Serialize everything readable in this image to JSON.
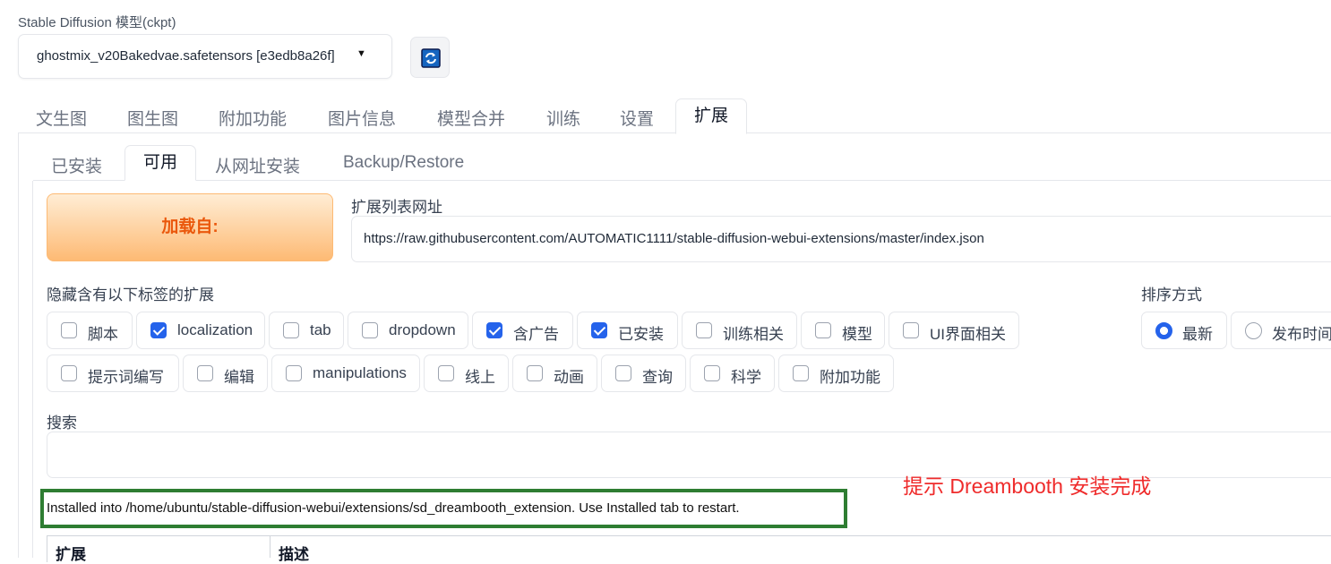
{
  "model": {
    "label": "Stable Diffusion 模型(ckpt)",
    "selected": "ghostmix_v20Bakedvae.safetensors [e3edb8a26f]"
  },
  "icons": {
    "refresh": "refresh-icon",
    "dropdown": "caret-down-icon"
  },
  "main_tabs": [
    "文生图",
    "图生图",
    "附加功能",
    "图片信息",
    "模型合并",
    "训练",
    "设置",
    "扩展"
  ],
  "main_tab_active": "扩展",
  "sub_tabs": [
    "已安装",
    "可用",
    "从网址安装",
    "Backup/Restore"
  ],
  "sub_tab_active": "可用",
  "load_button": "加载自:",
  "url": {
    "label": "扩展列表网址",
    "value": "https://raw.githubusercontent.com/AUTOMATIC1111/stable-diffusion-webui-extensions/master/index.json"
  },
  "hide_label": "隐藏含有以下标签的扩展",
  "tags_row1": [
    {
      "label": "脚本",
      "checked": false
    },
    {
      "label": "localization",
      "checked": true
    },
    {
      "label": "tab",
      "checked": false
    },
    {
      "label": "dropdown",
      "checked": false
    },
    {
      "label": "含广告",
      "checked": true
    },
    {
      "label": "已安装",
      "checked": true
    },
    {
      "label": "训练相关",
      "checked": false
    },
    {
      "label": "模型",
      "checked": false
    },
    {
      "label": "UI界面相关",
      "checked": false
    }
  ],
  "tags_row2": [
    {
      "label": "提示词编写",
      "checked": false
    },
    {
      "label": "编辑",
      "checked": false
    },
    {
      "label": "manipulations",
      "checked": false
    },
    {
      "label": "线上",
      "checked": false
    },
    {
      "label": "动画",
      "checked": false
    },
    {
      "label": "查询",
      "checked": false
    },
    {
      "label": "科学",
      "checked": false
    },
    {
      "label": "附加功能",
      "checked": false
    }
  ],
  "sort": {
    "label": "排序方式",
    "options": [
      {
        "label": "最新",
        "selected": true
      },
      {
        "label": "发布时间",
        "selected": false
      }
    ]
  },
  "search": {
    "label": "搜索",
    "value": ""
  },
  "annotation": "提示 Dreambooth 安装完成",
  "install_message": "Installed into /home/ubuntu/stable-diffusion-webui/extensions/sd_dreambooth_extension. Use Installed tab to restart.",
  "table": {
    "headers": [
      "扩展",
      "描述"
    ]
  },
  "colors": {
    "accent": "#2563eb",
    "load_button_text": "#ea580c",
    "annotation": "#ef2b2b",
    "highlight_border": "#2e7d32"
  }
}
